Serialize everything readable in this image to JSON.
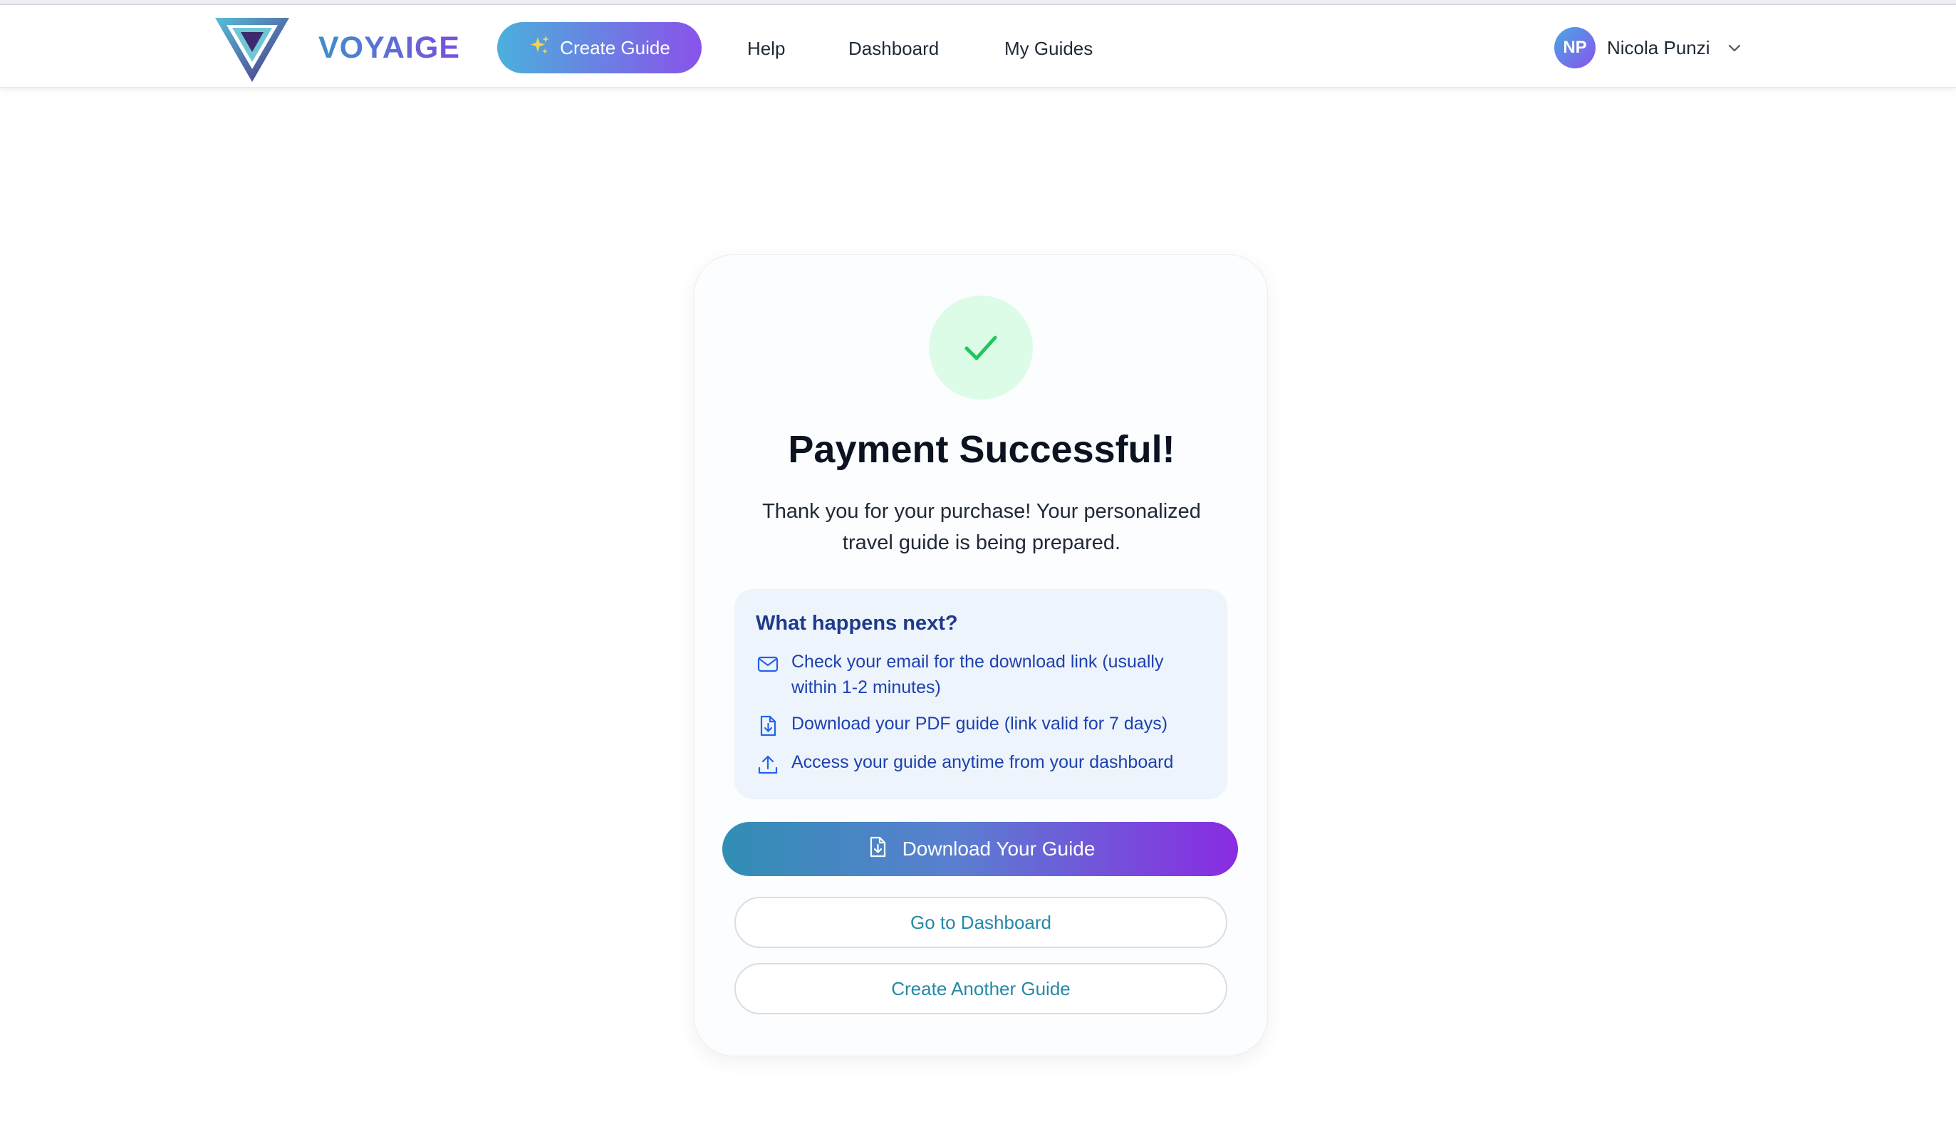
{
  "header": {
    "brand": "VOYAIGE",
    "create_button": "Create Guide",
    "nav": [
      "Help",
      "Dashboard",
      "My Guides"
    ],
    "user": {
      "initials": "NP",
      "name": "Nicola Punzi"
    }
  },
  "card": {
    "title": "Payment Successful!",
    "subtitle": "Thank you for your purchase! Your personalized travel guide is being prepared.",
    "next": {
      "heading": "What happens next?",
      "items": [
        {
          "icon": "mail-icon",
          "text": "Check your email for the download link (usually within 1-2 minutes)"
        },
        {
          "icon": "file-download-icon",
          "text": "Download your PDF guide (link valid for 7 days)"
        },
        {
          "icon": "upload-icon",
          "text": "Access your guide anytime from your dashboard"
        }
      ]
    },
    "download_button": "Download Your Guide",
    "dashboard_button": "Go to Dashboard",
    "another_button": "Create Another Guide"
  },
  "colors": {
    "accent_start": "#4bb0dc",
    "accent_end": "#8a52ea",
    "success_bg": "#dcfce7",
    "success_check": "#22c55e",
    "info_text": "#1e40af",
    "link_text": "#2589a6"
  }
}
